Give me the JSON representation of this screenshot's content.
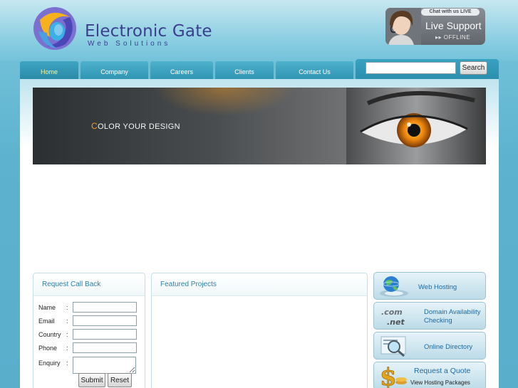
{
  "header": {
    "logo_title": "Electronic Gate",
    "logo_subtitle": "Web Solutions",
    "live_support": {
      "chat_tag": "Chat with us LIVE",
      "title": "Live Support",
      "status": "▸▸ OFFLINE"
    }
  },
  "nav": {
    "items": [
      {
        "label": "Home",
        "active": true
      },
      {
        "label": "Company"
      },
      {
        "label": "Careers"
      },
      {
        "label": "Clients"
      },
      {
        "label": "Contact Us"
      }
    ],
    "search": {
      "value": "",
      "placeholder": "",
      "button_label": "Search"
    }
  },
  "banner": {
    "first_letter": "C",
    "rest": "OLOR YOUR DESIGN"
  },
  "callback": {
    "title": "Request Call Back",
    "fields": [
      {
        "label": "Name",
        "colon": ":"
      },
      {
        "label": "Email",
        "colon": ":"
      },
      {
        "label": "Country",
        "colon": ":"
      },
      {
        "label": "Phone",
        "colon": ":"
      },
      {
        "label": "Enquiry",
        "colon": ":"
      }
    ],
    "submit_label": "Submit",
    "reset_label": "Reset"
  },
  "featured": {
    "title": "Featured Projects"
  },
  "sidebar": {
    "items": [
      {
        "label": "Web Hosting",
        "icon": "globe-icon"
      },
      {
        "label": "Domain Availability",
        "label2": "Checking",
        "icon": "domain-icon"
      },
      {
        "label": "Online Directory",
        "icon": "magnifier-icon"
      },
      {
        "label": "Request a Quote",
        "label2": "View Hosting Packages",
        "icon": "dollar-icon"
      }
    ]
  },
  "colors": {
    "brand": "#3b3f8e",
    "nav_bg": "#2f95b3",
    "accent_link": "#2e7fa8"
  }
}
